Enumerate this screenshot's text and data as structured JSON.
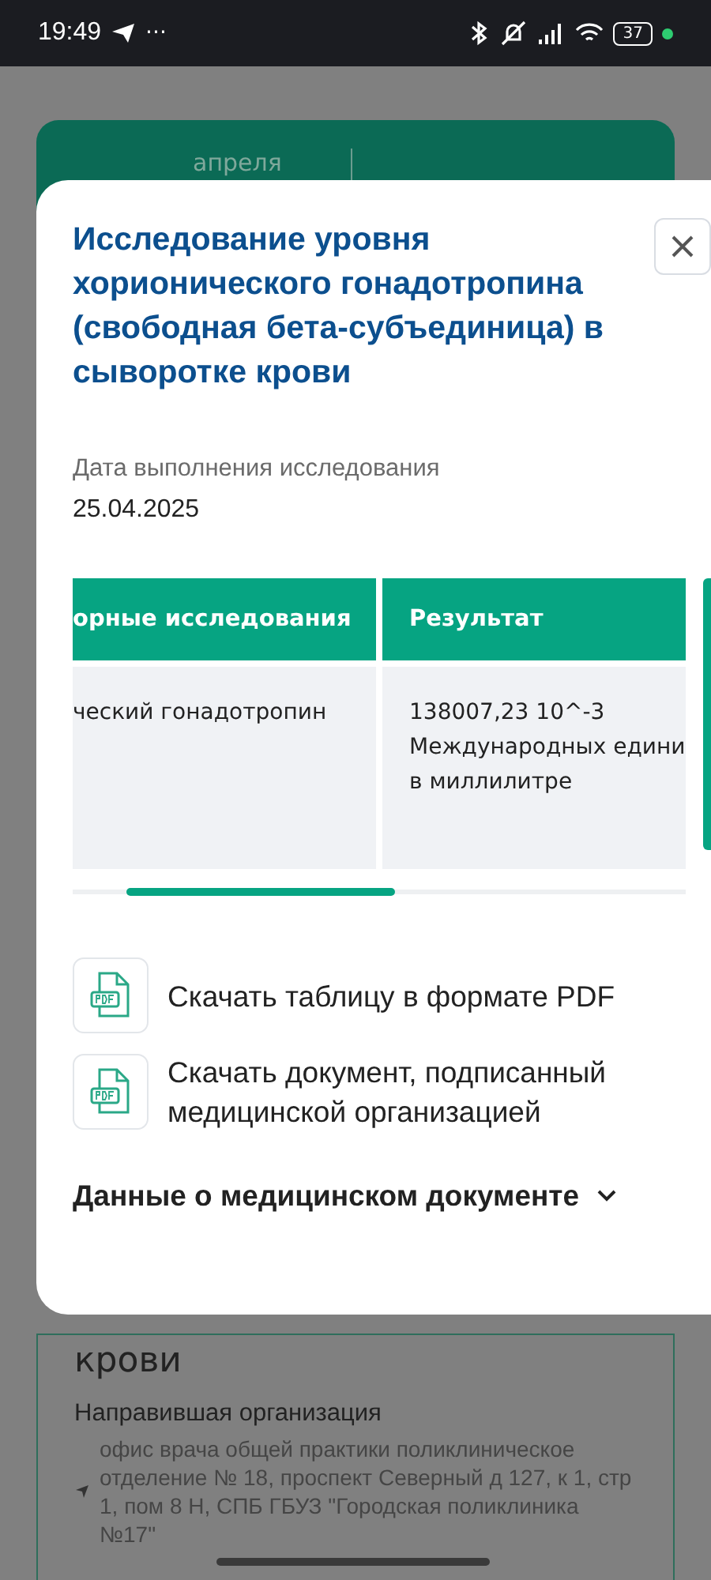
{
  "status_bar": {
    "time": "19:49",
    "more": "···",
    "battery": "37"
  },
  "background": {
    "date_month": "апреля",
    "card_title_tail": "крови",
    "referrer_label": "Направившая организация",
    "referrer_value": "офис врача общей практики поликлиническое отделение № 18, проспект Северный д 127, к 1, стр 1, пом 8 Н, СПБ ГБУЗ \"Городская поликлиника №17\""
  },
  "modal": {
    "title": "Исследование уровня хорионического гонадотропина (свободная бета-субъединица) в сыворотке крови",
    "date_label": "Дата выполнения исследования",
    "date_value": "25.04.2025",
    "table": {
      "columns": [
        "орные исследования",
        "Результат"
      ],
      "rows": [
        [
          "ческий гонадотропин",
          "138007,23 10^-3\nМеждународных едини\nв миллилитре"
        ]
      ]
    },
    "downloads": [
      "Скачать таблицу в формате PDF",
      "Скачать документ, подписанный медицинской организацией"
    ],
    "details": {
      "label": "Данные о медицинском документе",
      "expanded": false
    }
  }
}
